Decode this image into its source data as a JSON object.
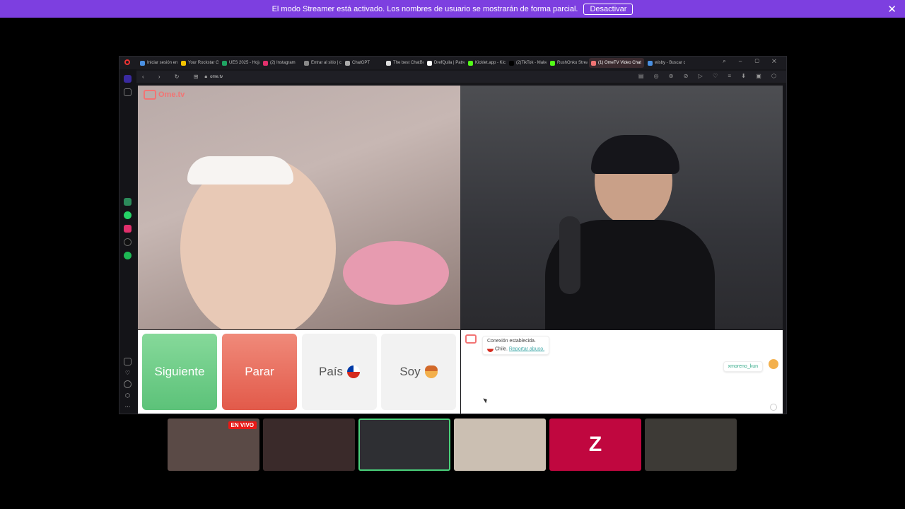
{
  "banner": {
    "message": "El modo Streamer está activado. Los nombres de usuario se mostrarán de forma parcial.",
    "button_label": "Desactivar",
    "close_glyph": "✕"
  },
  "browser": {
    "tabs": [
      {
        "label": "Iniciar sesión en",
        "color": "#4a90e2"
      },
      {
        "label": "Your Rockstar Ga",
        "color": "#f2c200"
      },
      {
        "label": "UES 2025 - Hoja",
        "color": "#1fa463"
      },
      {
        "label": "(2) Instagram",
        "color": "#e1306c"
      },
      {
        "label": "Entrar al sitio | co",
        "color": "#888888"
      },
      {
        "label": "ChatGPT",
        "color": "#aaaaaa"
      },
      {
        "label": "The best ChatBo",
        "color": "#dddddd"
      },
      {
        "label": "DrefQuila | Patre",
        "color": "#ffffff"
      },
      {
        "label": "Kicklet.app - Kick",
        "color": "#53fc18"
      },
      {
        "label": "(2)TikTok - Make",
        "color": "#000000"
      },
      {
        "label": "RushOnku Stream",
        "color": "#53fc18"
      },
      {
        "label": "(1) OmeTV Video Chat",
        "color": "#f27474",
        "active": true
      },
      {
        "label": "wisby - Buscar co",
        "color": "#4a90e2"
      }
    ],
    "url": "ome.tv"
  },
  "app": {
    "logo_text": "Ome.tv",
    "buttons": {
      "next": "Siguiente",
      "stop": "Parar",
      "country": "País",
      "me": "Soy"
    },
    "chat": {
      "status": "Conexión establecida.",
      "country": "Chile.",
      "report": "Reportar abuso.",
      "username": "xmoreno_kun"
    }
  },
  "thumbnails": {
    "live_badge": "EN VIVO",
    "items": [
      {
        "name": "thumb-1",
        "live": true,
        "bg": "#5a4a46"
      },
      {
        "name": "thumb-2",
        "bg": "#3a2a2a"
      },
      {
        "name": "thumb-3",
        "selected": true,
        "bg": "#2e2f33"
      },
      {
        "name": "thumb-4",
        "bg": "#cbbfb2"
      },
      {
        "name": "thumb-5",
        "bg": "#c0073f",
        "logo": "Z"
      },
      {
        "name": "thumb-6",
        "bg": "#3d3a36"
      }
    ]
  }
}
